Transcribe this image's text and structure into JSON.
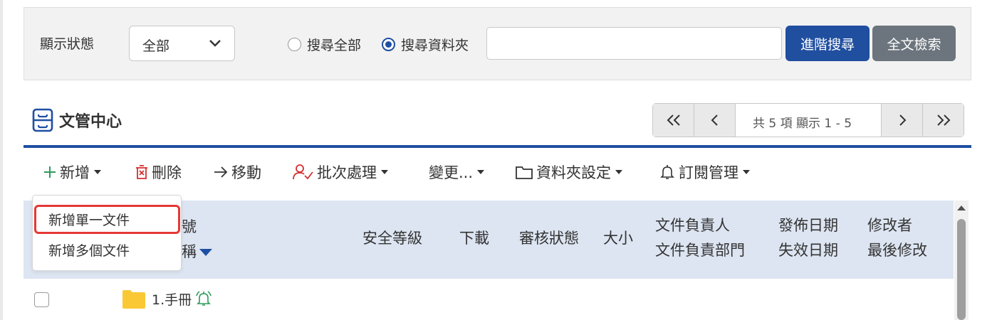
{
  "filter": {
    "status_label": "顯示狀態",
    "status_value": "全部",
    "radio_all": "搜尋全部",
    "radio_folder": "搜尋資料夾",
    "search_value": "",
    "advanced_search": "進階搜尋",
    "fulltext_search": "全文檢索"
  },
  "section": {
    "title": "文管中心",
    "icon": "cabinet-icon"
  },
  "pager": {
    "info": "共 5 項 顯示 1 - 5",
    "first_icon": "double-chevron-left-icon",
    "prev_icon": "chevron-left-icon",
    "next_icon": "chevron-right-icon",
    "last_icon": "double-chevron-right-icon"
  },
  "toolbar": {
    "add": "新增",
    "delete": "刪除",
    "move": "移動",
    "batch": "批次處理",
    "change": "變更...",
    "folder_settings": "資料夾設定",
    "subscription": "訂閱管理"
  },
  "dropdown": {
    "items": [
      "新增單一文件",
      "新增多個文件"
    ],
    "highlighted_index": 0
  },
  "table": {
    "header_partial_1": "號",
    "header_partial_2": "稱",
    "security": "安全等級",
    "download": "下載",
    "review_status": "審核狀態",
    "size": "大小",
    "owner": "文件負責人",
    "owner_dept": "文件負責部門",
    "publish_date": "發佈日期",
    "expire_date": "失效日期",
    "modifier": "修改者",
    "last_modified": "最後修改",
    "rows": [
      {
        "name": "1.手冊",
        "type_icon": "folder-icon",
        "subscribed_icon": "bell-icon"
      }
    ]
  },
  "colors": {
    "primary": "#214fa0",
    "secondary": "#6c757d",
    "header_bg": "#dde5f2",
    "highlight": "#e53935",
    "folder": "#f9c834",
    "bell": "#2e9b5b"
  }
}
